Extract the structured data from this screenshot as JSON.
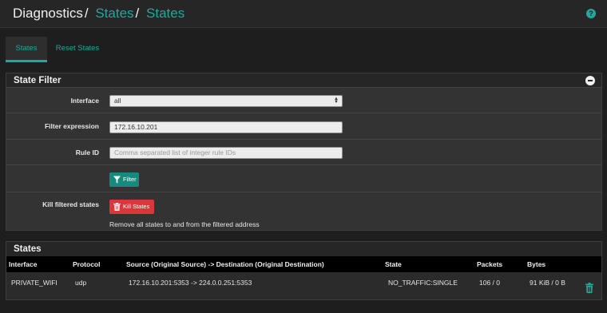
{
  "breadcrumb": {
    "root": "Diagnostics",
    "section": "States",
    "page": "States",
    "separator": "/"
  },
  "help_icon": "question-circle-icon",
  "tabs": [
    {
      "label": "States",
      "active": true
    },
    {
      "label": "Reset States",
      "active": false
    }
  ],
  "filter_panel": {
    "title": "State Filter",
    "interface": {
      "label": "Interface",
      "value": "all"
    },
    "filter_expression": {
      "label": "Filter expression",
      "value": "172.16.10.201"
    },
    "rule_id": {
      "label": "Rule ID",
      "value": "",
      "placeholder": "Comma separated list of integer rule IDs"
    },
    "filter_button": {
      "label": "Filter",
      "icon": "filter-icon"
    },
    "kill": {
      "label": "Kill filtered states",
      "button_label": "Kill States",
      "icon": "trash-icon",
      "help": "Remove all states to and from the filtered address"
    }
  },
  "states_panel": {
    "title": "States",
    "columns": [
      "Interface",
      "Protocol",
      "Source (Original Source) -> Destination (Original Destination)",
      "State",
      "Packets",
      "Bytes"
    ],
    "rows": [
      {
        "interface": "PRIVATE_WIFI",
        "protocol": "udp",
        "source_destination": "172.16.10.201:5353 -> 224.0.0.251:5353",
        "state": "NO_TRAFFIC:SINGLE",
        "packets": "106 / 0",
        "bytes": "91 KiB / 0 B"
      }
    ]
  },
  "colors": {
    "accent": "#26a69a",
    "danger": "#d9383a",
    "background": "#1e1e1e",
    "panel": "#333333"
  }
}
